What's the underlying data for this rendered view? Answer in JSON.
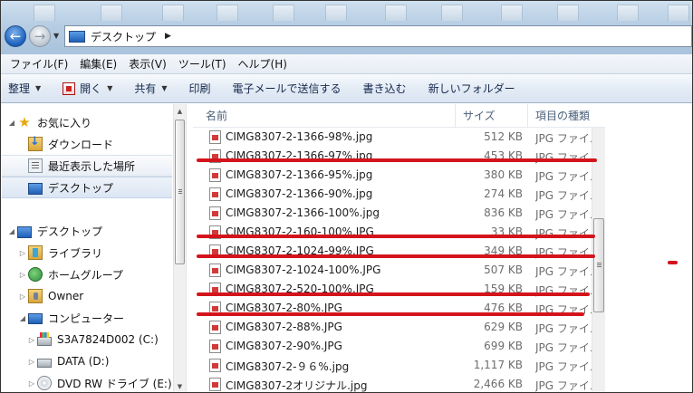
{
  "address": {
    "location": "デスクトップ",
    "separator": "▶"
  },
  "menu": [
    "ファイル(F)",
    "編集(E)",
    "表示(V)",
    "ツール(T)",
    "ヘルプ(H)"
  ],
  "toolbar": {
    "organize": "整理",
    "open": "開く",
    "share": "共有",
    "print": "印刷",
    "email": "電子メールで送信する",
    "burn": "書き込む",
    "new_folder": "新しいフォルダー"
  },
  "nav": {
    "favorites": "お気に入り",
    "downloads": "ダウンロード",
    "recent": "最近表示した場所",
    "desktop_fav": "デスクトップ",
    "desktop": "デスクトップ",
    "libraries": "ライブラリ",
    "homegroup": "ホームグループ",
    "owner": "Owner",
    "computer": "コンピューター",
    "drive_c": "S3A7824D002 (C:)",
    "drive_d": "DATA (D:)",
    "drive_e": "DVD RW ドライブ (E:)"
  },
  "columns": {
    "name": "名前",
    "size": "サイズ",
    "type": "項目の種類"
  },
  "files": [
    {
      "name": "CIMG8307-2-1366-98%.jpg",
      "size": "512 KB",
      "type": "JPG ファイル"
    },
    {
      "name": "CIMG8307-2-1366-97%.jpg",
      "size": "453 KB",
      "type": "JPG ファイル"
    },
    {
      "name": "CIMG8307-2-1366-95%.jpg",
      "size": "380 KB",
      "type": "JPG ファイル"
    },
    {
      "name": "CIMG8307-2-1366-90%.jpg",
      "size": "274 KB",
      "type": "JPG ファイル"
    },
    {
      "name": "CIMG8307-2-1366-100%.jpg",
      "size": "836 KB",
      "type": "JPG ファイル"
    },
    {
      "name": "CIMG8307-2-160-100%.JPG",
      "size": "33 KB",
      "type": "JPG ファイル"
    },
    {
      "name": "CIMG8307-2-1024-99%.JPG",
      "size": "349 KB",
      "type": "JPG ファイル"
    },
    {
      "name": "CIMG8307-2-1024-100%.JPG",
      "size": "507 KB",
      "type": "JPG ファイル"
    },
    {
      "name": "CIMG8307-2-520-100%.JPG",
      "size": "159 KB",
      "type": "JPG ファイル"
    },
    {
      "name": "CIMG8307-2-80%.JPG",
      "size": "476 KB",
      "type": "JPG ファイル"
    },
    {
      "name": "CIMG8307-2-88%.JPG",
      "size": "629 KB",
      "type": "JPG ファイル"
    },
    {
      "name": "CIMG8307-2-90%.JPG",
      "size": "699 KB",
      "type": "JPG ファイル"
    },
    {
      "name": "CIMG8307-2-９６%.jpg",
      "size": "1,117 KB",
      "type": "JPG ファイル"
    },
    {
      "name": "CIMG8307-2オリジナル.jpg",
      "size": "2,466 KB",
      "type": "JPG ファイル"
    }
  ],
  "colors": {
    "annotation_red": "#d4141c"
  }
}
